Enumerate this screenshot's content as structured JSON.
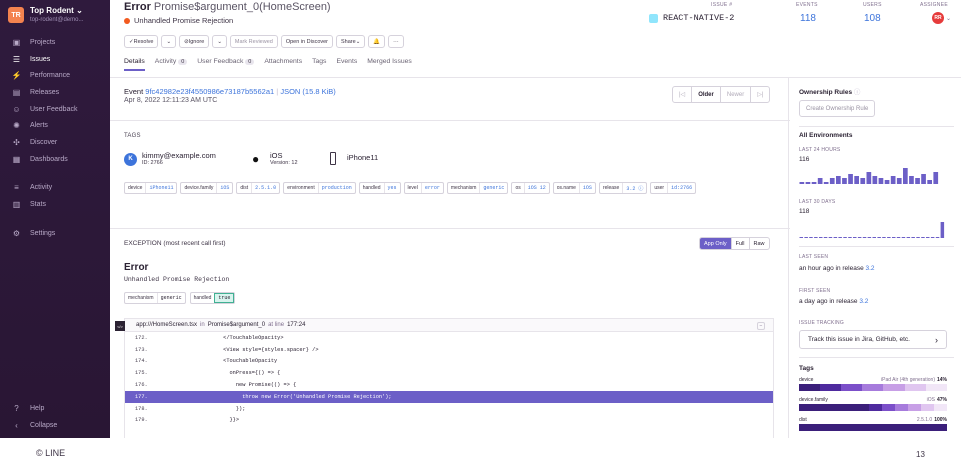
{
  "sidebar": {
    "org_initials": "TR",
    "org_name": "Top Rodent",
    "org_sub": "top-rodent@demo...",
    "items": [
      {
        "label": "Projects",
        "icon": "projects-icon",
        "glyph": "▣"
      },
      {
        "label": "Issues",
        "icon": "issues-icon",
        "glyph": "☰",
        "active": true
      },
      {
        "label": "Performance",
        "icon": "performance-icon",
        "glyph": "⚡"
      },
      {
        "label": "Releases",
        "icon": "releases-icon",
        "glyph": "▤"
      },
      {
        "label": "User Feedback",
        "icon": "user-feedback-icon",
        "glyph": "☺"
      },
      {
        "label": "Alerts",
        "icon": "alerts-icon",
        "glyph": "✺"
      },
      {
        "label": "Discover",
        "icon": "discover-icon",
        "glyph": "✣"
      },
      {
        "label": "Dashboards",
        "icon": "dashboards-icon",
        "glyph": "▦"
      }
    ],
    "items2": [
      {
        "label": "Activity",
        "icon": "activity-icon",
        "glyph": "≡"
      },
      {
        "label": "Stats",
        "icon": "stats-icon",
        "glyph": "▥"
      }
    ],
    "items3": [
      {
        "label": "Settings",
        "icon": "settings-icon",
        "glyph": "⚙"
      }
    ],
    "bottom": [
      {
        "label": "Help",
        "icon": "help-icon",
        "glyph": "?"
      },
      {
        "label": "Collapse",
        "icon": "collapse-icon",
        "glyph": "‹"
      }
    ]
  },
  "header": {
    "error": "Error",
    "location": "Promise$argument_0(HomeScreen)",
    "message": "Unhandled Promise Rejection",
    "toolbar": [
      "Resolve",
      "",
      "Ignore",
      "",
      "Mark Reviewed",
      "Open in Discover",
      "Share",
      "",
      "···"
    ],
    "tabs": [
      {
        "label": "Details",
        "active": true
      },
      {
        "label": "Activity",
        "count": "0"
      },
      {
        "label": "User Feedback",
        "count": "0"
      },
      {
        "label": "Attachments"
      },
      {
        "label": "Tags"
      },
      {
        "label": "Events"
      },
      {
        "label": "Merged Issues"
      }
    ],
    "issue_label": "ISSUE #",
    "issue_id": "REACT-NATIVE-2",
    "events_label": "EVENTS",
    "events_value": "118",
    "users_label": "USERS",
    "users_value": "108",
    "assignee_label": "ASSIGNEE",
    "assignee_initials": "RR"
  },
  "event": {
    "prefix": "Event",
    "id": "9fc42982e23f4550986e73187b5562a1",
    "json": "JSON (15.8 KiB)",
    "date": "Apr 8, 2022 12:11:23 AM UTC",
    "pager": [
      "|◁",
      "Older",
      "Newer",
      "▷|"
    ]
  },
  "tags": {
    "title": "TAGS",
    "user_email": "kimmy@example.com",
    "user_id": "ID: 2766",
    "user_initial": "K",
    "os": "iOS",
    "os_version": "Version: 12",
    "device": "iPhone11",
    "pills": [
      {
        "k": "device",
        "v": "iPhone11"
      },
      {
        "k": "device.family",
        "v": "iOS"
      },
      {
        "k": "dist",
        "v": "2.5.1.0"
      },
      {
        "k": "environment",
        "v": "production"
      },
      {
        "k": "handled",
        "v": "yes"
      },
      {
        "k": "level",
        "v": "error"
      },
      {
        "k": "mechanism",
        "v": "generic"
      },
      {
        "k": "os",
        "v": "iOS 12"
      },
      {
        "k": "os.name",
        "v": "iOS"
      },
      {
        "k": "release",
        "v": "3.2 ⓘ"
      },
      {
        "k": "user",
        "v": "id:2766"
      }
    ]
  },
  "exception": {
    "title": "EXCEPTION (most recent call first)",
    "modes": [
      "App Only",
      "Full",
      "Raw"
    ],
    "heading": "Error",
    "message": "Unhandled Promise Rejection",
    "mechanism_k": "mechanism",
    "mechanism_v": "generic",
    "handled_k": "handled",
    "handled_v": "true",
    "frame_file": "app:///HomeScreen.tsx",
    "frame_in": "in",
    "frame_fn": "Promise$argument_0",
    "frame_at": "at line",
    "frame_line": "177:24",
    "frame_badge": "</>",
    "collapse_glyph": "−",
    "lines": [
      {
        "n": "172.",
        "code": "            </TouchableOpacity>"
      },
      {
        "n": "173.",
        "code": "            <View style={styles.spacer} />"
      },
      {
        "n": "174.",
        "code": "            <TouchableOpacity"
      },
      {
        "n": "175.",
        "code": "              onPress={() => {"
      },
      {
        "n": "176.",
        "code": "                new Promise(() => {"
      },
      {
        "n": "177.",
        "code": "                  throw new Error('Unhandled Promise Rejection');",
        "hl": true
      },
      {
        "n": "178.",
        "code": "                });"
      },
      {
        "n": "179.",
        "code": "              }}>"
      }
    ]
  },
  "right": {
    "ownership": "Ownership Rules",
    "create_rule": "Create Ownership Rule",
    "all_env": "All Environments",
    "last24_label": "LAST 24 HOURS",
    "last24_value": "116",
    "last30_label": "LAST 30 DAYS",
    "last30_value": "118",
    "last_seen_label": "LAST SEEN",
    "last_seen_text": "an hour ago in release",
    "last_seen_release": "3.2",
    "first_seen_label": "FIRST SEEN",
    "first_seen_text": "a day ago in release",
    "first_seen_release": "3.2",
    "tracking_label": "ISSUE TRACKING",
    "tracking_btn": "Track this issue in Jira, GitHub, etc.",
    "tracking_arrow": "›",
    "tags_title": "Tags",
    "tag_rows": [
      {
        "name": "device",
        "detail": "iPad Air (4th generation)",
        "pct": "14%"
      },
      {
        "name": "device.family",
        "detail": "iOS",
        "pct": "47%"
      },
      {
        "name": "dist",
        "detail": "2.5.1.0",
        "pct": "100%"
      }
    ],
    "spark24": [
      1,
      1,
      1,
      3,
      1,
      3,
      4,
      3,
      5,
      4,
      3,
      6,
      4,
      3,
      2,
      4,
      3,
      8,
      4,
      3,
      5,
      2,
      6
    ],
    "spark30": [
      0,
      0,
      0,
      0,
      0,
      0,
      0,
      0,
      0,
      0,
      0,
      0,
      0,
      0,
      0,
      0,
      0,
      0,
      0,
      0,
      0,
      0,
      0,
      0,
      0,
      0,
      0,
      0,
      0,
      10
    ]
  },
  "footer": {
    "logo": "© LINE",
    "page": "13"
  },
  "colors": {
    "accent": "#6c5fc7",
    "link": "#3d74db",
    "sidebar": "#2f1a3d",
    "error_dot": "#f25a1f"
  }
}
